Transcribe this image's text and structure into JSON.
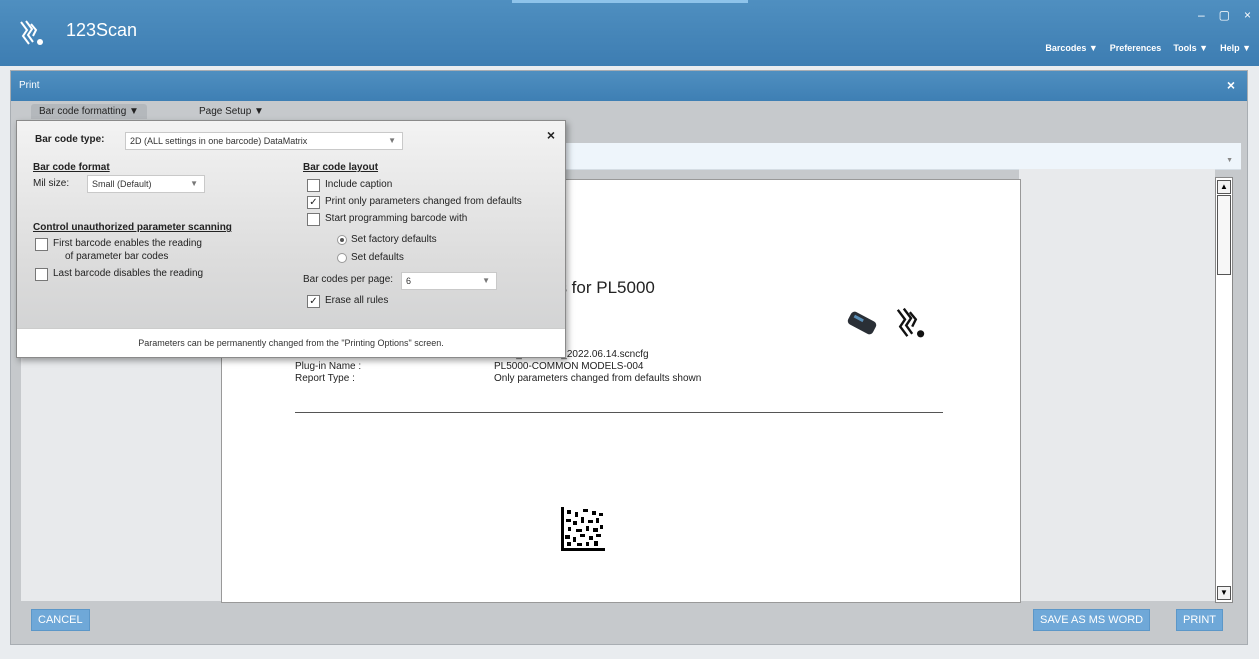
{
  "app": {
    "title": "123Scan",
    "window_controls": [
      "–",
      "▢",
      "×"
    ],
    "menu": [
      "Barcodes ▼",
      "Preferences",
      "Tools ▼",
      "Help ▼"
    ]
  },
  "dialog": {
    "title": "Print",
    "close": "×",
    "tabs": [
      "Bar code formatting ▼",
      "Page Setup ▼"
    ],
    "cancel_label": "CANCEL",
    "save_word_label": "SAVE AS MS WORD",
    "print_label": "PRINT"
  },
  "popup": {
    "close": "×",
    "barcode_type_label": "Bar code type:",
    "barcode_type_value": "2D (ALL settings in one barcode) DataMatrix",
    "format_heading": "Bar code format",
    "mil_size_label": "Mil size:",
    "mil_size_value": "Small (Default)",
    "control_heading": "Control unauthorized parameter scanning",
    "first_barcode_line1": "First barcode enables the reading",
    "first_barcode_line2": "of parameter bar codes",
    "last_barcode": "Last barcode disables the reading",
    "layout_heading": "Bar code layout",
    "include_caption": "Include caption",
    "print_only_changed": "Print only parameters changed from defaults",
    "start_programming": "Start programming barcode with",
    "set_factory_defaults": "Set factory defaults",
    "set_defaults": "Set defaults",
    "per_page_label": "Bar codes per page:",
    "per_page_value": "6",
    "erase_all_rules": "Erase all rules",
    "footer": "Parameters can be permanently changed from the \"Printing Options\" screen."
  },
  "document": {
    "title_fragment": "es for PL5000",
    "config_fragment": "5000_Untitled1_2022.06.14.scncfg",
    "plugin_label": "Plug-in Name :",
    "plugin_value": "PL5000-COMMON MODELS-004",
    "report_label": "Report Type :",
    "report_value": "Only parameters changed from defaults shown"
  }
}
